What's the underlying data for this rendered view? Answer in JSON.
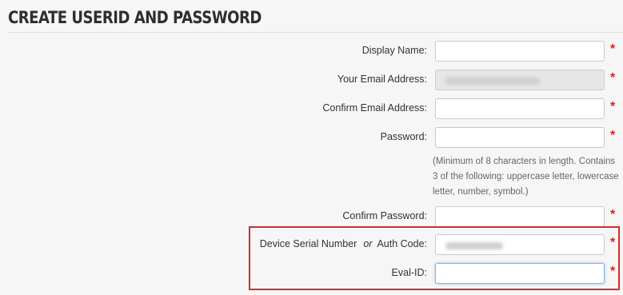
{
  "page": {
    "title": "Create UserID and Password"
  },
  "form": {
    "required_marker": "*",
    "display_name": {
      "label": "Display Name:",
      "value": ""
    },
    "email": {
      "label": "Your Email Address:",
      "value": ""
    },
    "confirm_email": {
      "label": "Confirm Email Address:",
      "value": ""
    },
    "password": {
      "label": "Password:",
      "value": "",
      "hint": "(Minimum of 8 characters in length. Contains 3 of the following: uppercase letter, lowercase letter, number, symbol.)"
    },
    "confirm_password": {
      "label": "Confirm Password:",
      "value": ""
    },
    "serial": {
      "label_part1": "Device Serial Number",
      "label_or": "or",
      "label_part2": "Auth Code:",
      "value": ""
    },
    "eval_id": {
      "label": "Eval-ID:",
      "value": ""
    }
  },
  "colors": {
    "required": "#e21c1c",
    "highlight_border": "#d92b2b",
    "focus_border": "#7fb6e6"
  }
}
